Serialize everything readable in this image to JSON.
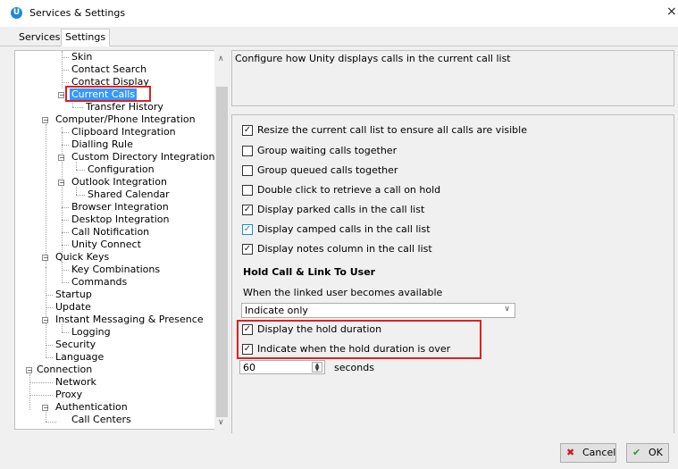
{
  "window": {
    "title": "Services & Settings",
    "close_glyph": "×",
    "app_icon_letter": "U"
  },
  "tabs": [
    {
      "label": "Services"
    },
    {
      "label": "Settings",
      "active": true
    }
  ],
  "tree": {
    "items": [
      {
        "label": "Skin"
      },
      {
        "label": "Contact Search"
      },
      {
        "label": "Contact Display"
      },
      {
        "label": "Current Calls",
        "selected": true
      },
      {
        "label": "Transfer History"
      },
      {
        "label": "Computer/Phone Integration"
      },
      {
        "label": "Clipboard Integration"
      },
      {
        "label": "Dialling Rule"
      },
      {
        "label": "Custom Directory Integration"
      },
      {
        "label": "Configuration"
      },
      {
        "label": "Outlook Integration"
      },
      {
        "label": "Shared Calendar"
      },
      {
        "label": "Browser Integration"
      },
      {
        "label": "Desktop Integration"
      },
      {
        "label": "Call Notification"
      },
      {
        "label": "Unity Connect"
      },
      {
        "label": "Quick Keys"
      },
      {
        "label": "Key Combinations"
      },
      {
        "label": "Commands"
      },
      {
        "label": "Startup"
      },
      {
        "label": "Update"
      },
      {
        "label": "Instant Messaging & Presence"
      },
      {
        "label": "Logging"
      },
      {
        "label": "Security"
      },
      {
        "label": "Language"
      },
      {
        "label": "Connection"
      },
      {
        "label": "Network"
      },
      {
        "label": "Proxy"
      },
      {
        "label": "Authentication"
      },
      {
        "label": "Call Centers"
      }
    ]
  },
  "panel": {
    "description": "Configure how Unity displays calls in the current call list",
    "options": [
      {
        "label": "Resize the current call list to ensure all calls are visible",
        "checked": true
      },
      {
        "label": "Group waiting calls together",
        "checked": false
      },
      {
        "label": "Group queued calls together",
        "checked": false
      },
      {
        "label": "Double click to retrieve a call on hold",
        "checked": false
      },
      {
        "label": "Display parked calls in the call list",
        "checked": true
      },
      {
        "label": "Display camped calls in the call list",
        "checked": true
      },
      {
        "label": "Display notes column in the call list",
        "checked": true
      }
    ],
    "hold_section_title": "Hold Call & Link To User",
    "linked_user_label": "When the linked user becomes available",
    "linked_user_value": "Indicate only",
    "hold_options": [
      {
        "label": "Display the hold duration",
        "checked": true
      },
      {
        "label": "Indicate when the hold duration is over",
        "checked": true
      }
    ],
    "hold_seconds": "60",
    "hold_unit": "seconds"
  },
  "buttons": {
    "cancel": "Cancel",
    "ok": "OK"
  },
  "colors": {
    "highlight": "#e02020",
    "selection": "#3399ff",
    "accent_check": "#1e88d6"
  }
}
